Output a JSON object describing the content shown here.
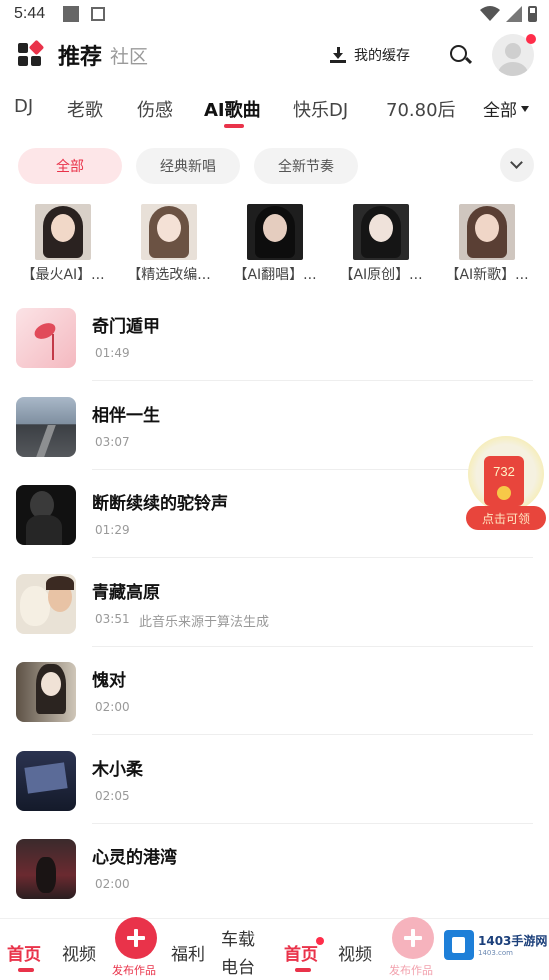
{
  "status_bar": {
    "time": "5:44"
  },
  "header": {
    "title": "推荐",
    "subtitle": "社区",
    "cache_label": "我的缓存"
  },
  "category_tabs": [
    "DJ",
    "老歌",
    "伤感",
    "AI歌曲",
    "快乐DJ",
    "70.80后"
  ],
  "category_active": "AI歌曲",
  "category_all_label": "全部",
  "filters": [
    "全部",
    "经典新唱",
    "全新节奏"
  ],
  "filter_active": "全部",
  "playlists": [
    {
      "name": "【最火AI】..."
    },
    {
      "name": "【精选改编..."
    },
    {
      "name": "【AI翻唱】..."
    },
    {
      "name": "【AI原创】..."
    },
    {
      "name": "【AI新歌】..."
    }
  ],
  "songs": [
    {
      "title": "奇门遁甲",
      "duration": "01:49",
      "note": ""
    },
    {
      "title": "相伴一生",
      "duration": "03:07",
      "note": ""
    },
    {
      "title": "断断续续的驼铃声",
      "duration": "01:29",
      "note": ""
    },
    {
      "title": "青藏高原",
      "duration": "03:51",
      "note": "此音乐来源于算法生成"
    },
    {
      "title": "愧对",
      "duration": "02:00",
      "note": ""
    },
    {
      "title": "木小柔",
      "duration": "02:05",
      "note": ""
    },
    {
      "title": "心灵的港湾",
      "duration": "02:00",
      "note": ""
    }
  ],
  "reward": {
    "amount": "732",
    "label": "点击可领"
  },
  "bottom_nav": {
    "home": "首页",
    "video": "视频",
    "publish": "发布作品",
    "welfare": "福利",
    "car_radio": "车载电台",
    "home2": "首页",
    "video2": "视频",
    "publish2": "发布作品"
  },
  "watermark": {
    "title": "1403手游网",
    "url": "1403.com"
  },
  "colors": {
    "accent": "#e9334a",
    "pill_bg": "#f3f3f3",
    "pill_active_bg": "#fde6e8"
  }
}
